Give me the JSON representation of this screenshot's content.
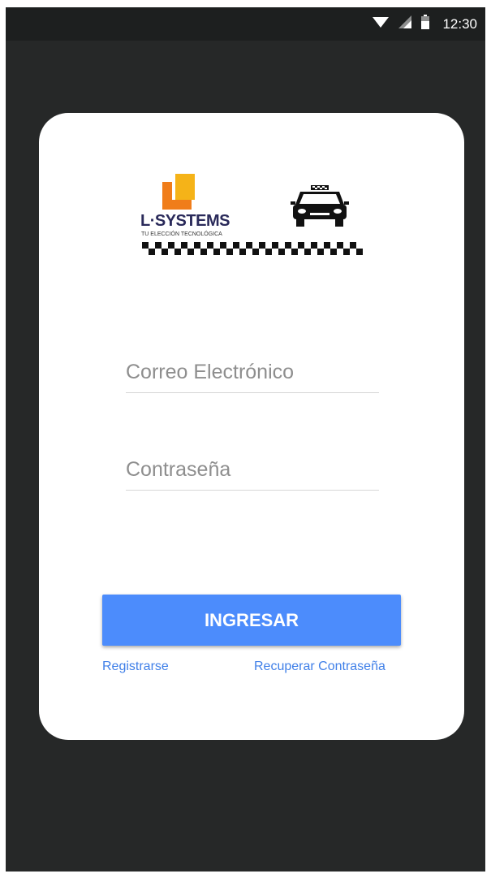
{
  "status_bar": {
    "time": "12:30",
    "icons": [
      "wifi-icon",
      "signal-icon",
      "battery-icon"
    ]
  },
  "logo": {
    "brand": "L·SYSTEMS",
    "tagline": "TU ELECCIÓN TECNOLÓGICA",
    "icons": [
      "l-systems-logo-icon",
      "taxi-icon",
      "checkered-flag-icon"
    ]
  },
  "form": {
    "email_placeholder": "Correo Electrónico",
    "password_placeholder": "Contraseña",
    "email_value": "",
    "password_value": ""
  },
  "actions": {
    "login_label": "INGRESAR",
    "register_label": "Registrarse",
    "recover_label": "Recuperar Contraseña"
  },
  "colors": {
    "background": "#262828",
    "status_bar": "#1d1f1f",
    "card": "#ffffff",
    "accent": "#4c8cfc",
    "link": "#3f7fe8",
    "logo_orange": "#f07d1a",
    "logo_gold": "#f5b318"
  }
}
